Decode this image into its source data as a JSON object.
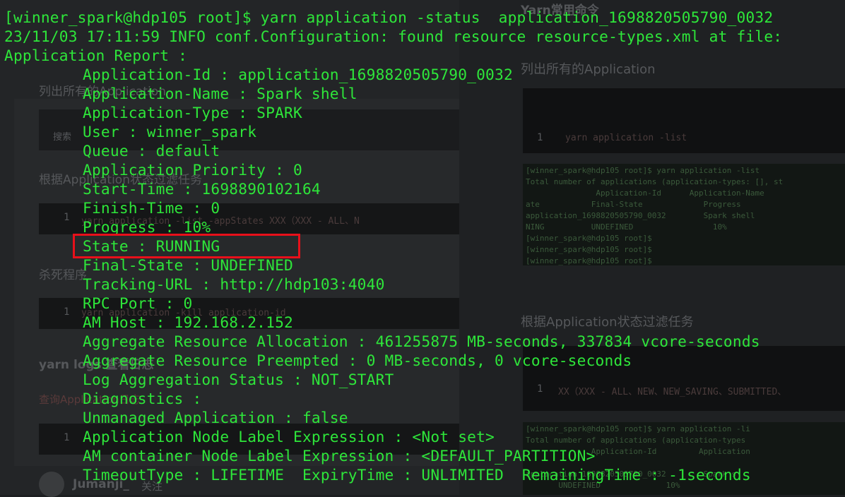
{
  "background": {
    "left_headings": [
      "列出所有的Application",
      "根据Application状态过滤任务",
      "杀死程序",
      "yarn logs 查看日志",
      "查询Application日志"
    ],
    "search_label": "搜索",
    "left_code": [
      "yarn application -list -appStates XXX（XXX - ALL、N",
      "yarn application -kill application-id"
    ],
    "author": "Jumanji_",
    "follow_label": "关注",
    "right_title": "Yarn常用命令",
    "right_headings": [
      "列出所有的Application",
      "根据Application状态过滤任务"
    ],
    "right_code": [
      "yarn application -list",
      "XX（XXX - ALL、NEW、NEW_SAVING、SUBMITTED、"
    ],
    "right_term_1": "[winner_spark@hdp105 root]$ yarn application -list\nTotal number of applications (application-types: [], st\n               Application-Id      Application-Name\nate           Final-State             Progress\napplication_1698820505790_0032        Spark shell\nNING          UNDEFINED                 10%\n[winner_spark@hdp105 root]$\n[winner_spark@hdp105 root]$\n[winner_spark@hdp105 root]$",
    "right_term_2": "[winner_spark@hdp105 root]$ yarn application -li\nTotal number of applications (application-types\n              Application-Id         Application\n\napplication_1698820505790_0032        Spark s\n       UNDEFINED              10%"
  },
  "terminal": {
    "prompt_line": "[winner_spark@hdp105 root]$ yarn application -status  application_1698820505790_0032",
    "info_line": "23/11/03 17:11:59 INFO conf.Configuration: found resource resource-types.xml at file:",
    "report_title": "Application Report :",
    "fields": [
      "Application-Id : application_1698820505790_0032",
      "Application-Name : Spark shell",
      "Application-Type : SPARK",
      "User : winner_spark",
      "Queue : default",
      "Application Priority : 0",
      "Start-Time : 1698890102164",
      "Finish-Time : 0",
      "Progress : 10%",
      "State : RUNNING",
      "Final-State : UNDEFINED",
      "Tracking-URL : http://hdp103:4040",
      "RPC Port : 0",
      "AM Host : 192.168.2.152",
      "Aggregate Resource Allocation : 461255875 MB-seconds, 337834 vcore-seconds",
      "Aggregate Resource Preempted : 0 MB-seconds, 0 vcore-seconds",
      "Log Aggregation Status : NOT_START",
      "Diagnostics :",
      "Unmanaged Application : false",
      "Application Node Label Expression : <Not set>",
      "AM container Node Label Expression : <DEFAULT_PARTITION>",
      "TimeoutType : LIFETIME  ExpiryTime : UNLIMITED  RemainingTime : -1seconds"
    ],
    "highlight_color": "#e8101a",
    "text_color": "#2ee63a"
  }
}
